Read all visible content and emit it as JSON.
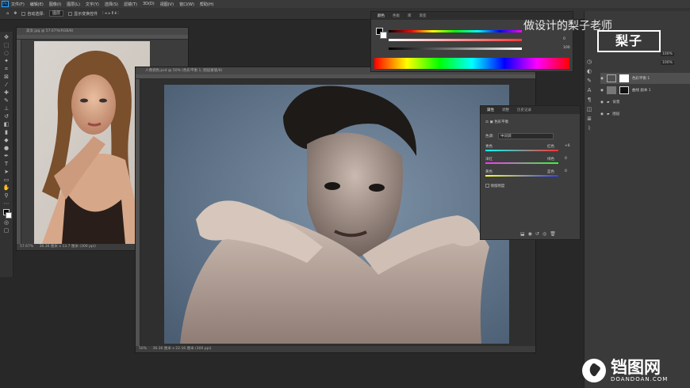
{
  "menubar": {
    "logo": "Ps",
    "items": [
      "文件(F)",
      "编辑(E)",
      "图像(I)",
      "图层(L)",
      "文字(Y)",
      "选择(S)",
      "滤镜(T)",
      "3D(D)",
      "视图(V)",
      "窗口(W)",
      "帮助(H)"
    ]
  },
  "options": {
    "auto_select": "自动选择:",
    "group": "图层",
    "transform": "显示变换控件"
  },
  "doc1": {
    "tab": "美女.jpg @ 57.67%(RGB/8)",
    "zoom": "57.67%",
    "size": "36.36 厘米 x 13.7 厘米 (300 ppi)"
  },
  "doc2": {
    "tab": "人像调色.psd @ 50% (色彩平衡 1, 图层蒙版/8)",
    "zoom": "50%",
    "size": "36.36 厘米 x 22.16 厘米 (300 ppi)"
  },
  "color_panel": {
    "tabs": [
      "颜色",
      "色板",
      "库",
      "渐变"
    ],
    "rows": [
      {
        "name": "R",
        "value": "0"
      },
      {
        "name": "G",
        "value": "0"
      },
      {
        "name": "B",
        "value": "100"
      }
    ]
  },
  "properties": {
    "tabs": [
      "属性",
      "调整",
      "历史记录"
    ],
    "title": "色彩平衡",
    "tone_label": "色调:",
    "tone_value": "中间调",
    "rows": [
      {
        "left": "青色",
        "right": "红色",
        "value": "+6"
      },
      {
        "left": "洋红",
        "right": "绿色",
        "value": "0"
      },
      {
        "left": "黄色",
        "right": "蓝色",
        "value": "0"
      }
    ],
    "preserve": "保留明度"
  },
  "layers": {
    "opacity": "100%",
    "fill": "100%",
    "items": [
      {
        "name": "色彩平衡 1"
      },
      {
        "name": "曲线 副本 1"
      },
      {
        "name": "背景"
      },
      {
        "name": "图层"
      }
    ]
  },
  "watermarks": {
    "top_text": "做设计的梨子老师",
    "logo_text": "梨子",
    "site_big": "铛图网",
    "site_small": "DOANDOAN.COM"
  },
  "colors": {
    "accent": "#31a8ff",
    "canvas_bg": "#282828",
    "panel_bg": "#3e3e3e"
  }
}
